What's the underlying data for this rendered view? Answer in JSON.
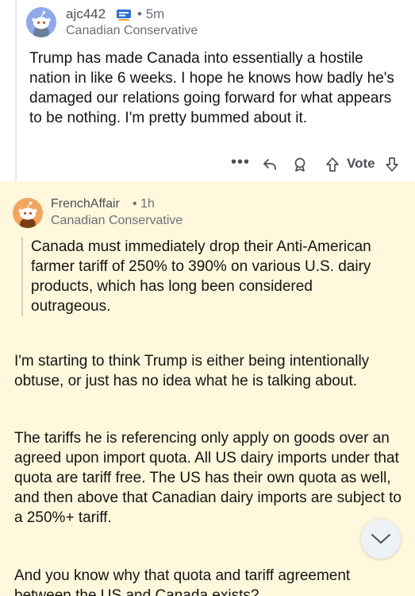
{
  "comments": [
    {
      "username": "ajc442",
      "badge_icon": "collectible-avatar-badge-icon",
      "time": "5m",
      "flair": "Canadian Conservative",
      "body": "Trump has made Canada into essentially a hostile nation in like 6 weeks.  I hope he knows how badly he's damaged our relations going forward for what appears to be nothing.  I'm pretty bummed about it.",
      "actions": {
        "more": "•••",
        "vote_label": "Vote"
      }
    },
    {
      "username": "FrenchAffair",
      "time": "1h",
      "flair": "Canadian Conservative",
      "quote": "Canada must immediately drop their Anti-American farmer tariff of 250% to 390% on various U.S. dairy products, which has long been considered outrageous.",
      "paragraphs": [
        "I'm starting to think Trump is either being intentionally obtuse, or just has no idea what he is talking about.",
        "The tariffs he is referencing only apply on goods over an agreed upon import quota. All US dairy imports under that quota are tariff free. The US has their own quota as well, and then above that Canadian dairy imports are subject to a 250%+ tariff.",
        "And you know why that quota and tariff agreement between the US and Canada exists?"
      ],
      "highlight_color": "#fff8dc"
    }
  ],
  "scroll_button_icon": "chevron-down-icon"
}
